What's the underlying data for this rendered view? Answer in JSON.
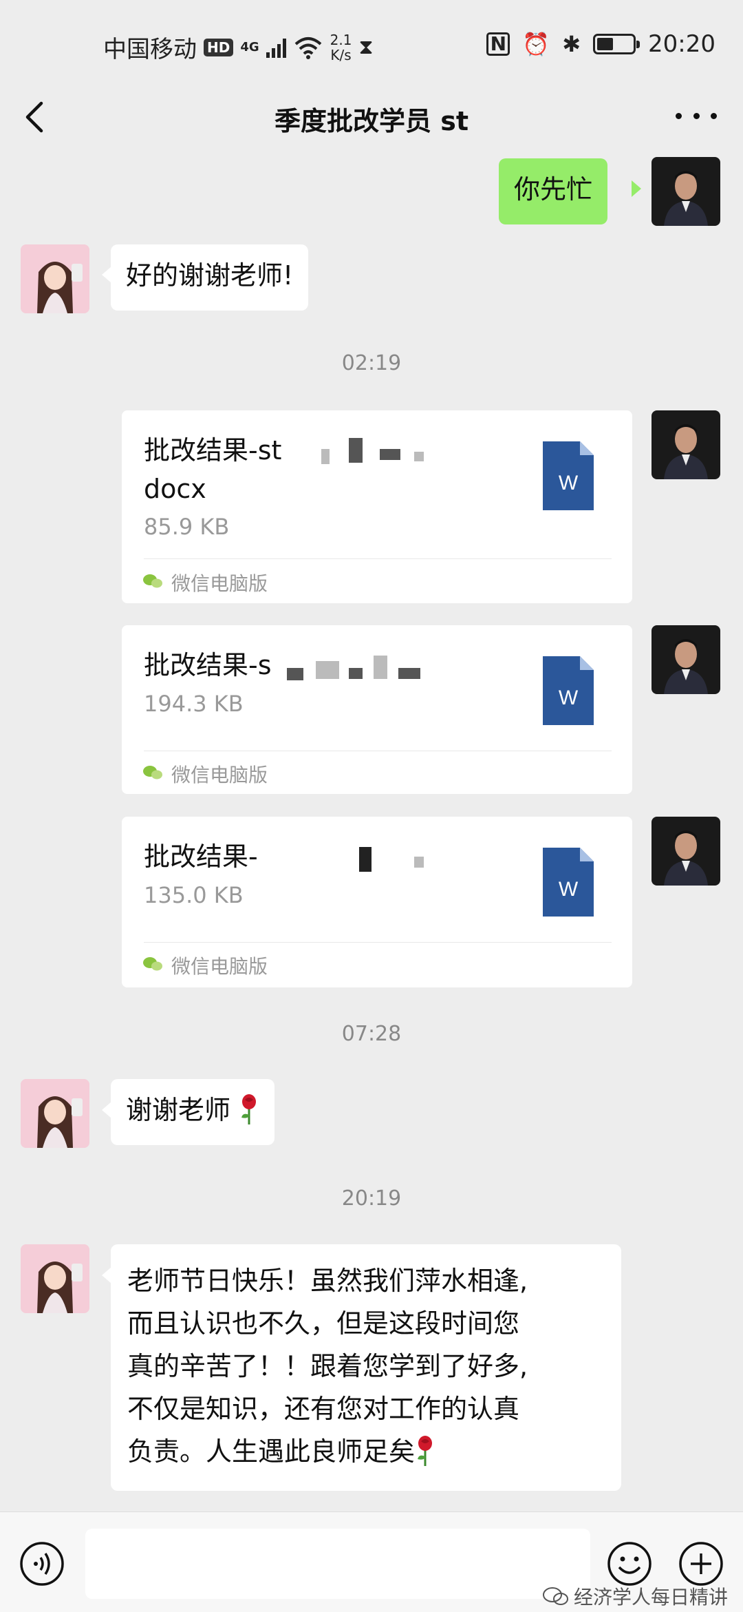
{
  "status_bar": {
    "carrier": "中国移动",
    "hd": "HD",
    "network": "4G",
    "speed_value": "2.1",
    "speed_unit": "K/s",
    "nfc": "N",
    "time": "20:20",
    "battery_level": 0.45
  },
  "header": {
    "title": "季度批改学员 st",
    "icons": [
      "back-arrow-icon",
      "more-icon"
    ]
  },
  "messages": [
    {
      "type": "text",
      "side": "out",
      "text": "你先忙"
    },
    {
      "type": "text",
      "side": "in",
      "text": "好的谢谢老师!"
    },
    {
      "type": "time",
      "text": "02:19"
    },
    {
      "type": "file",
      "side": "out",
      "name_line1": "批改结果-st",
      "name_line2": "docx",
      "size": "85.9 KB",
      "source": "微信电脑版"
    },
    {
      "type": "file",
      "side": "out",
      "name_line1": "批改结果-s",
      "size": "194.3 KB",
      "source": "微信电脑版"
    },
    {
      "type": "file",
      "side": "out",
      "name_line1": "批改结果-",
      "size": "135.0 KB",
      "source": "微信电脑版"
    },
    {
      "type": "time",
      "text": "07:28"
    },
    {
      "type": "text",
      "side": "in",
      "text": "谢谢老师",
      "emoji": "rose"
    },
    {
      "type": "time",
      "text": "20:19"
    },
    {
      "type": "text",
      "side": "in",
      "lines": [
        "老师节日快乐！虽然我们萍水相逢,",
        "而且认识也不久，但是这段时间您",
        "真的辛苦了！！跟着您学到了好多,",
        "不仅是知识，还有您对工作的认真",
        "负责。人生遇此良师足矣"
      ],
      "emoji": "rose"
    }
  ],
  "file_icon_label": "W",
  "watermark": "经济学人每日精讲",
  "colors": {
    "out_bubble": "#95ec69",
    "in_bubble": "#ffffff",
    "background": "#ededed",
    "word_blue": "#2b579a"
  }
}
